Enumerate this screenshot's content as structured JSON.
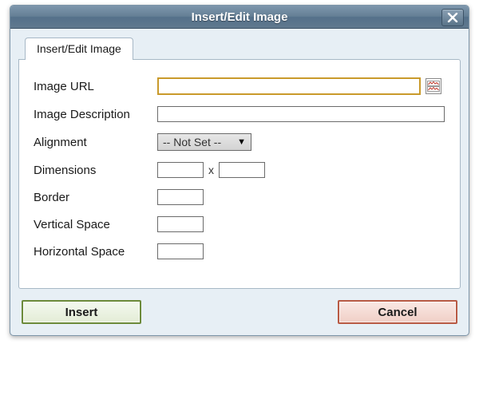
{
  "dialog": {
    "title": "Insert/Edit Image",
    "tab_label": "Insert/Edit Image"
  },
  "fields": {
    "url": {
      "label": "Image URL",
      "value": "",
      "placeholder": ""
    },
    "desc": {
      "label": "Image Description",
      "value": ""
    },
    "alignment": {
      "label": "Alignment",
      "selected": "-- Not Set --"
    },
    "dimensions": {
      "label": "Dimensions",
      "width": "",
      "height": "",
      "separator": "x"
    },
    "border": {
      "label": "Border",
      "value": ""
    },
    "vspace": {
      "label": "Vertical Space",
      "value": ""
    },
    "hspace": {
      "label": "Horizontal Space",
      "value": ""
    }
  },
  "buttons": {
    "insert": "Insert",
    "cancel": "Cancel"
  }
}
